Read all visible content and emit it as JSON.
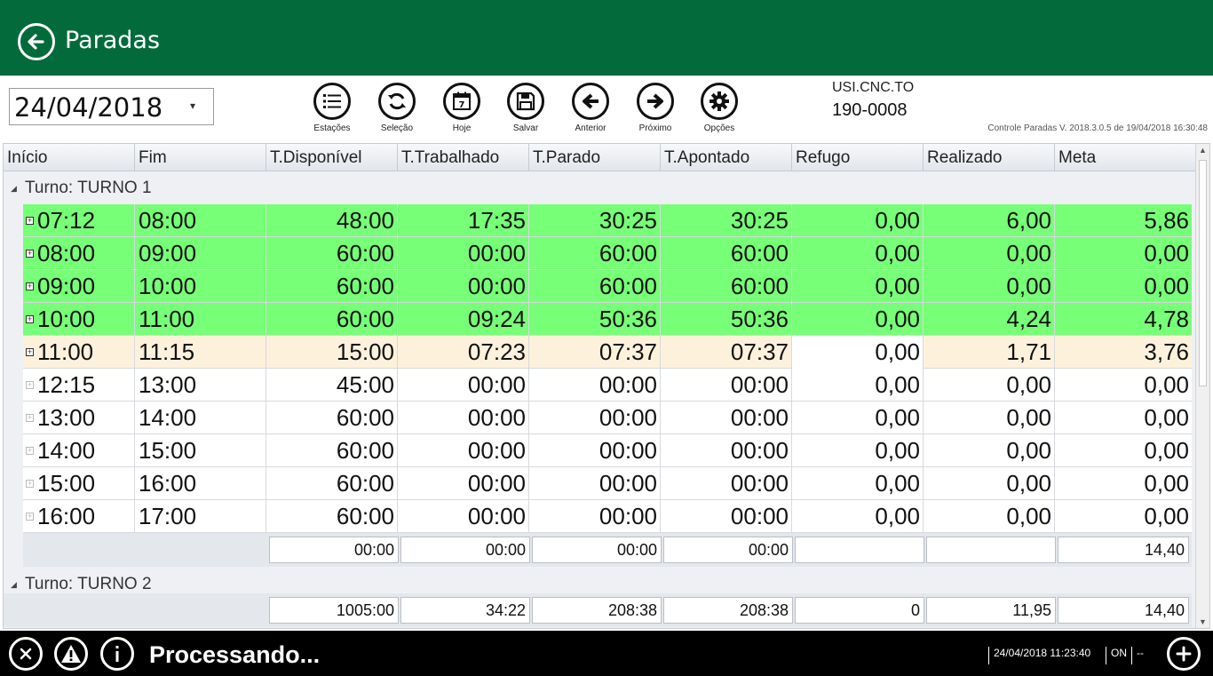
{
  "header": {
    "title": "Paradas"
  },
  "toolbar": {
    "date": "24/04/2018",
    "buttons": [
      {
        "label": "Estações",
        "icon": "list-icon"
      },
      {
        "label": "Seleção",
        "icon": "refresh-icon"
      },
      {
        "label": "Hoje",
        "icon": "calendar-icon"
      },
      {
        "label": "Salvar",
        "icon": "save-icon"
      },
      {
        "label": "Anterior",
        "icon": "arrow-left-icon"
      },
      {
        "label": "Próximo",
        "icon": "arrow-right-icon"
      },
      {
        "label": "Opções",
        "icon": "gear-icon"
      }
    ],
    "station_name": "USI.CNC.TO",
    "station_code": "190-0008",
    "version": "Controle Paradas V. 2018.3.0.5 de 19/04/2018 16:30:48"
  },
  "grid": {
    "columns": [
      "Início",
      "Fim",
      "T.Disponível",
      "T.Trabalhado",
      "T.Parado",
      "T.Apontado",
      "Refugo",
      "Realizado",
      "Meta"
    ],
    "groups": [
      {
        "label": "Turno: TURNO 1",
        "rows": [
          {
            "status": "ok",
            "cells": [
              "07:12",
              "08:00",
              "48:00",
              "17:35",
              "30:25",
              "30:25",
              "0,00",
              "6,00",
              "5,86"
            ]
          },
          {
            "status": "ok",
            "cells": [
              "08:00",
              "09:00",
              "60:00",
              "00:00",
              "60:00",
              "60:00",
              "0,00",
              "0,00",
              "0,00"
            ]
          },
          {
            "status": "ok",
            "cells": [
              "09:00",
              "10:00",
              "60:00",
              "00:00",
              "60:00",
              "60:00",
              "0,00",
              "0,00",
              "0,00"
            ]
          },
          {
            "status": "ok",
            "cells": [
              "10:00",
              "11:00",
              "60:00",
              "09:24",
              "50:36",
              "50:36",
              "0,00",
              "4,24",
              "4,78"
            ]
          },
          {
            "status": "current",
            "cells": [
              "11:00",
              "11:15",
              "15:00",
              "07:23",
              "07:37",
              "07:37",
              "0,00",
              "1,71",
              "3,76"
            ]
          },
          {
            "status": "future",
            "cells": [
              "12:15",
              "13:00",
              "45:00",
              "00:00",
              "00:00",
              "00:00",
              "0,00",
              "0,00",
              "0,00"
            ]
          },
          {
            "status": "future",
            "cells": [
              "13:00",
              "14:00",
              "60:00",
              "00:00",
              "00:00",
              "00:00",
              "0,00",
              "0,00",
              "0,00"
            ]
          },
          {
            "status": "future",
            "cells": [
              "14:00",
              "15:00",
              "60:00",
              "00:00",
              "00:00",
              "00:00",
              "0,00",
              "0,00",
              "0,00"
            ]
          },
          {
            "status": "future",
            "cells": [
              "15:00",
              "16:00",
              "60:00",
              "00:00",
              "00:00",
              "00:00",
              "0,00",
              "0,00",
              "0,00"
            ]
          },
          {
            "status": "future",
            "cells": [
              "16:00",
              "17:00",
              "60:00",
              "00:00",
              "00:00",
              "00:00",
              "0,00",
              "0,00",
              "0,00"
            ]
          }
        ],
        "summary": [
          "00:00",
          "00:00",
          "00:00",
          "00:00",
          "",
          "",
          "14,40"
        ]
      },
      {
        "label": "Turno: TURNO 2",
        "rows": [],
        "summary": null
      }
    ],
    "totals": [
      "1005:00",
      "34:22",
      "208:38",
      "208:38",
      "0",
      "11,95",
      "14,40"
    ]
  },
  "statusbar": {
    "message": "Processando...",
    "datetime": "24/04/2018 11:23:40",
    "mode": "ON",
    "extra": "--"
  },
  "colors": {
    "header": "#036a3c",
    "ok_row": "#77ff77",
    "current_row": "#fdf1dc",
    "future_row": "#ffffff"
  }
}
